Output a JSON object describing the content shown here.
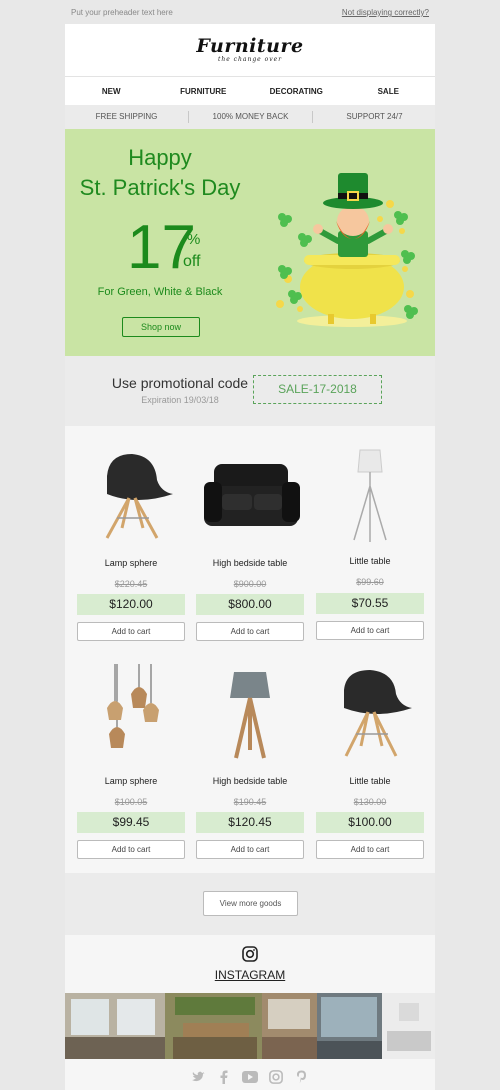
{
  "topbar": {
    "preheader": "Put your preheader text here",
    "view_link": "Not displaying correctly?"
  },
  "header": {
    "logo_title": "Furniture",
    "logo_tagline": "the change over"
  },
  "nav": {
    "items": [
      "NEW",
      "FURNITURE",
      "DECORATING",
      "SALE"
    ]
  },
  "benefits": [
    "FREE SHIPPING",
    "100% MONEY BACK",
    "SUPPORT 24/7"
  ],
  "hero": {
    "line1": "Happy",
    "line2": "St. Patrick's Day",
    "discount_number": "17",
    "discount_percent": "%",
    "discount_off": "off",
    "subtitle": "For Green, White & Black",
    "button": "Shop now",
    "colors": {
      "background": "#c9e4a4",
      "accent": "#1c8a1c"
    }
  },
  "promo": {
    "label": "Use promotional code",
    "expiration": "Expiration 19/03/18",
    "code": "SALE-17-2018"
  },
  "products": [
    {
      "name": "Lamp sphere",
      "old_price": "$220.45",
      "price": "$120.00",
      "cart": "Add to cart",
      "icon": "chair-icon"
    },
    {
      "name": "High bedside table",
      "old_price": "$900.00",
      "price": "$800.00",
      "cart": "Add to cart",
      "icon": "sofa-icon"
    },
    {
      "name": "Little table",
      "old_price": "$99.60",
      "price": "$70.55",
      "cart": "Add to cart",
      "icon": "floor-lamp-icon"
    },
    {
      "name": "Lamp sphere",
      "old_price": "$100.05",
      "price": "$99.45",
      "cart": "Add to cart",
      "icon": "pendant-lamps-icon"
    },
    {
      "name": "High bedside table",
      "old_price": "$190.45",
      "price": "$120.45",
      "cart": "Add to cart",
      "icon": "table-lamp-icon"
    },
    {
      "name": "Little table",
      "old_price": "$130.00",
      "price": "$100.00",
      "cart": "Add to cart",
      "icon": "chair-icon"
    }
  ],
  "more": {
    "button": "View more goods"
  },
  "instagram": {
    "label": "INSTAGRAM",
    "icon": "instagram-icon"
  },
  "social": [
    "twitter-icon",
    "facebook-icon",
    "youtube-icon",
    "instagram-icon",
    "pinterest-icon"
  ]
}
